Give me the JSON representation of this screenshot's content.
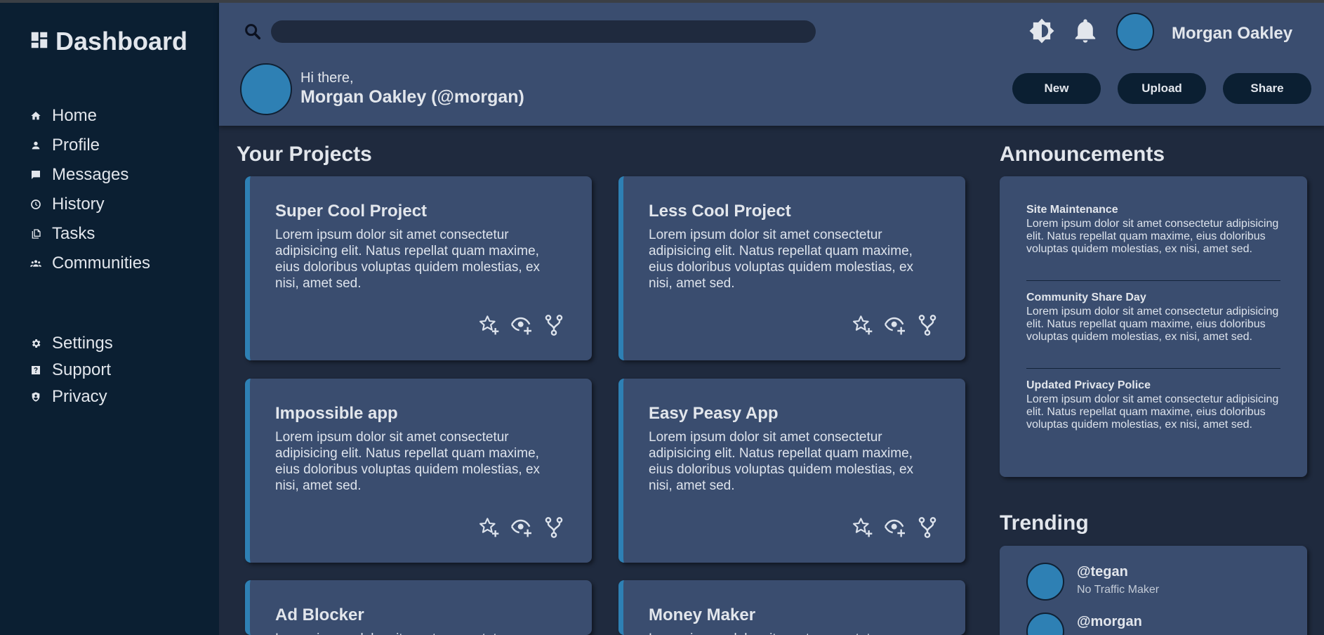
{
  "app": {
    "title": "Dashboard"
  },
  "sidebar": {
    "main": [
      {
        "label": "Home",
        "icon": "home-icon"
      },
      {
        "label": "Profile",
        "icon": "profile-icon"
      },
      {
        "label": "Messages",
        "icon": "messages-icon"
      },
      {
        "label": "History",
        "icon": "history-icon"
      },
      {
        "label": "Tasks",
        "icon": "tasks-icon"
      },
      {
        "label": "Communities",
        "icon": "communities-icon"
      }
    ],
    "secondary": [
      {
        "label": "Settings",
        "icon": "gear-icon"
      },
      {
        "label": "Support",
        "icon": "support-icon"
      },
      {
        "label": "Privacy",
        "icon": "shield-icon"
      }
    ]
  },
  "header": {
    "search": {
      "value": "",
      "placeholder": ""
    },
    "username": "Morgan Oakley",
    "greeting": "Hi there,",
    "display_name": "Morgan Oakley (@morgan)",
    "buttons": {
      "new": "New",
      "upload": "Upload",
      "share": "Share"
    }
  },
  "projects": {
    "title": "Your Projects",
    "cards": [
      {
        "title": "Super Cool Project",
        "desc": "Lorem ipsum dolor sit amet consectetur adipisicing elit. Natus repellat quam maxime, eius doloribus voluptas quidem molestias, ex nisi, amet sed."
      },
      {
        "title": "Less Cool Project",
        "desc": "Lorem ipsum dolor sit amet consectetur adipisicing elit. Natus repellat quam maxime, eius doloribus voluptas quidem molestias, ex nisi, amet sed."
      },
      {
        "title": "Impossible app",
        "desc": "Lorem ipsum dolor sit amet consectetur adipisicing elit. Natus repellat quam maxime, eius doloribus voluptas quidem molestias, ex nisi, amet sed."
      },
      {
        "title": "Easy Peasy App",
        "desc": "Lorem ipsum dolor sit amet consectetur adipisicing elit. Natus repellat quam maxime, eius doloribus voluptas quidem molestias, ex nisi, amet sed."
      },
      {
        "title": "Ad Blocker",
        "desc": "Lorem ipsum dolor sit amet consectetur adipisicing elit. Natus repellat quam maxime, eius doloribus voluptas quidem molestias, ex nisi, amet sed."
      },
      {
        "title": "Money Maker",
        "desc": "Lorem ipsum dolor sit amet consectetur adipisicing elit. Natus repellat quam maxime, eius doloribus voluptas quidem molestias, ex nisi, amet sed."
      }
    ]
  },
  "announcements": {
    "title": "Announcements",
    "items": [
      {
        "title": "Site Maintenance",
        "body": "Lorem ipsum dolor sit amet consectetur adipisicing elit. Natus repellat quam maxime, eius doloribus voluptas quidem molestias, ex nisi, amet sed."
      },
      {
        "title": "Community Share Day",
        "body": "Lorem ipsum dolor sit amet consectetur adipisicing elit. Natus repellat quam maxime, eius doloribus voluptas quidem molestias, ex nisi, amet sed."
      },
      {
        "title": "Updated Privacy Police",
        "body": "Lorem ipsum dolor sit amet consectetur adipisicing elit. Natus repellat quam maxime, eius doloribus voluptas quidem molestias, ex nisi, amet sed."
      }
    ]
  },
  "trending": {
    "title": "Trending",
    "items": [
      {
        "handle": "@tegan",
        "sub": "No Traffic Maker"
      },
      {
        "handle": "@morgan",
        "sub": ""
      }
    ]
  },
  "colors": {
    "sidebar": "#0b1f32",
    "header": "#3a4d6f",
    "background": "#1f2a3e",
    "accent": "#2e80b4"
  }
}
